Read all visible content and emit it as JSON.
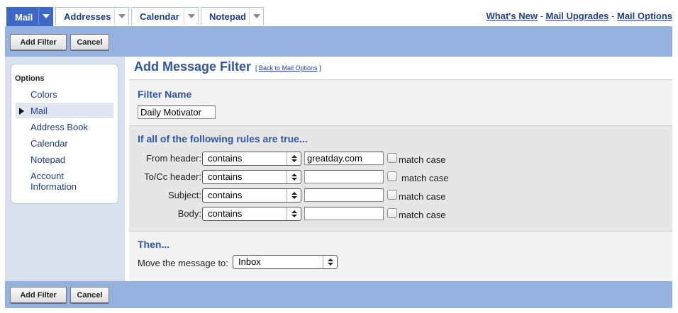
{
  "tabs": [
    {
      "label": "Mail",
      "active": true
    },
    {
      "label": "Addresses",
      "active": false
    },
    {
      "label": "Calendar",
      "active": false
    },
    {
      "label": "Notepad",
      "active": false
    }
  ],
  "toplinks": {
    "whats_new": "What's New",
    "sep1": "-",
    "mail_upgrades": "Mail Upgrades",
    "sep2": "-",
    "mail_options": "Mail Options"
  },
  "toolbar": {
    "add_filter": "Add Filter",
    "cancel": "Cancel"
  },
  "options": {
    "title": "Options",
    "items": [
      "Colors",
      "Mail",
      "Address Book",
      "Calendar",
      "Notepad",
      "Account Information"
    ],
    "selected": "Mail"
  },
  "page": {
    "title": "Add Message Filter",
    "back_open": "[",
    "back_link": "Back to Mail Options",
    "back_close": "]"
  },
  "filter_name": {
    "label": "Filter Name",
    "value": "Daily Motivator"
  },
  "rules": {
    "title": "If all of the following rules are true...",
    "rows": [
      {
        "label": "From header:",
        "op": "contains",
        "value": "greatday.com",
        "match_case": "match case",
        "checked": false
      },
      {
        "label": "To/Cc header:",
        "op": "contains",
        "value": "",
        "match_case": "match case",
        "checked": false
      },
      {
        "label": "Subject:",
        "op": "contains",
        "value": "",
        "match_case": "match case",
        "checked": false
      },
      {
        "label": "Body:",
        "op": "contains",
        "value": "",
        "match_case": "match case",
        "checked": false
      }
    ]
  },
  "then": {
    "title": "Then...",
    "move_label": "Move the message to:",
    "folder": "Inbox"
  },
  "colors": {
    "accent": "#3d68c8",
    "bar": "#95b1de",
    "link": "#1d3f86",
    "heading": "#2f56a6"
  }
}
